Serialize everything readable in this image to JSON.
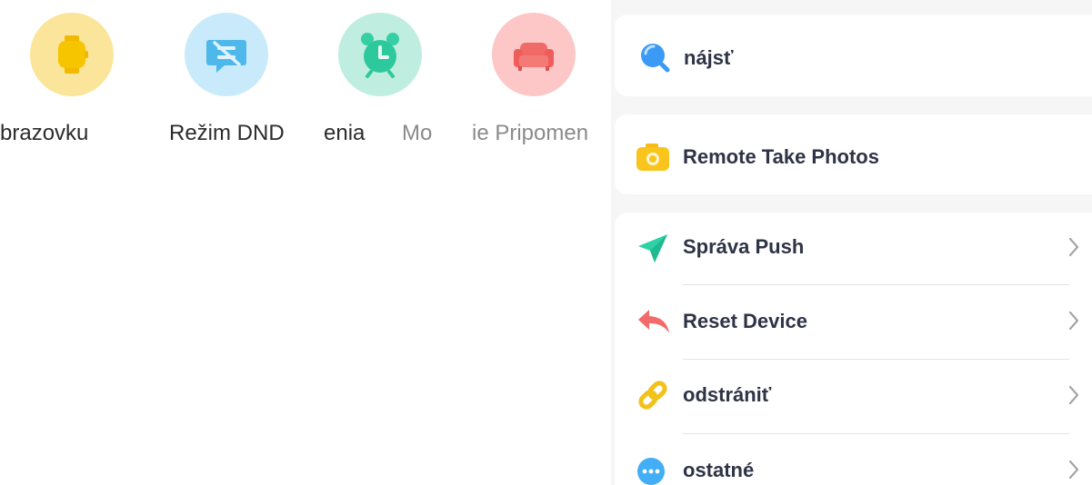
{
  "shortcuts": [
    {
      "label": "brazovku",
      "icon": "watch-icon",
      "color": "#fbe59a"
    },
    {
      "label": "Režim DND",
      "icon": "dnd-message-icon",
      "color": "#c8eafb"
    },
    {
      "label": "enia",
      "icon": "alarm-clock-icon",
      "color": "#bfeee0"
    },
    {
      "label": "Mo",
      "icon": "sofa-icon",
      "color": "#fcc7c6"
    },
    {
      "label": "ie Pripomen",
      "icon": "",
      "color": ""
    }
  ],
  "settings": {
    "find": {
      "label": "nájsť",
      "icon": "search-icon"
    },
    "remote_photo": {
      "label": "Remote Take Photos",
      "icon": "camera-icon"
    },
    "items": [
      {
        "label": "Správa Push",
        "icon": "send-icon"
      },
      {
        "label": "Reset Device",
        "icon": "reply-arrow-icon"
      },
      {
        "label": "odstrániť",
        "icon": "link-icon"
      },
      {
        "label": "ostatné",
        "icon": "more-dots-icon"
      }
    ]
  }
}
